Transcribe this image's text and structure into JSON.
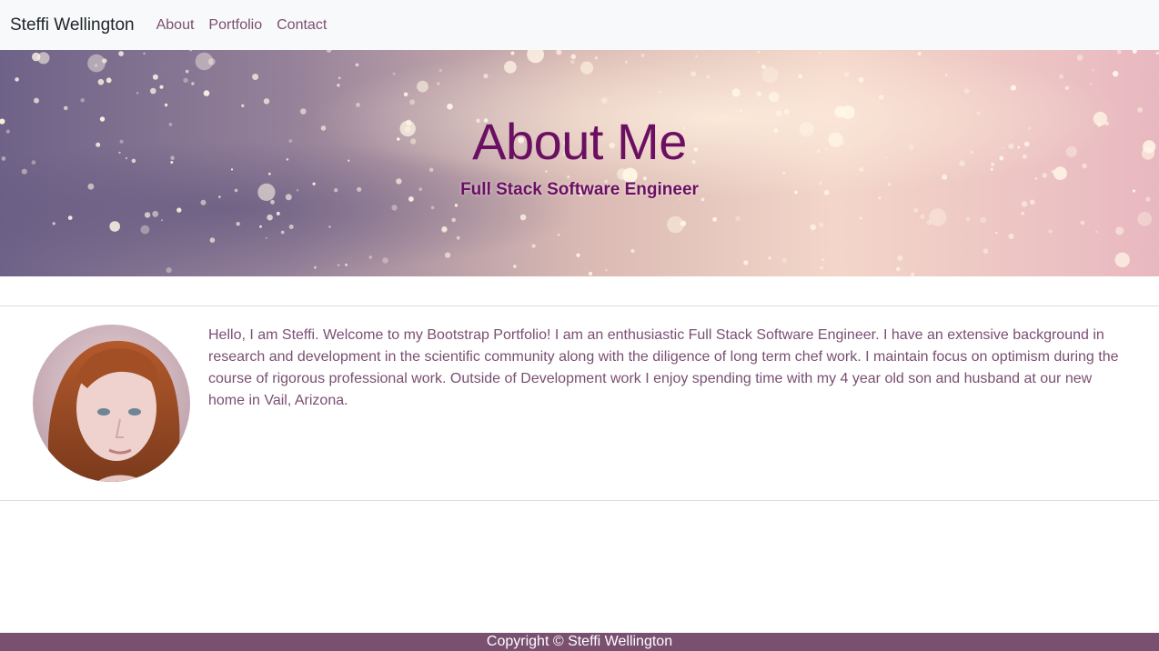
{
  "navbar": {
    "brand": "Steffi Wellington",
    "links": [
      {
        "label": "About"
      },
      {
        "label": "Portfolio"
      },
      {
        "label": "Contact"
      }
    ]
  },
  "hero": {
    "title": "About Me",
    "subtitle": "Full Stack Software Engineer"
  },
  "about": {
    "bio": "Hello, I am Steffi. Welcome to my Bootstrap Portfolio! I am an enthusiastic Full Stack Software Engineer. I have an extensive background in research and development in the scientific community along with the diligence of long term chef work. I maintain focus on optimism during the course of rigorous professional work. Outside of Development work I enjoy spending time with my 4 year old son and husband at our new home in Vail, Arizona."
  },
  "footer": {
    "copyright": "Copyright © Steffi Wellington"
  },
  "colors": {
    "accent": "#7a4f73",
    "hero_text": "#6b0f62",
    "footer_bg": "#7a5070",
    "navbar_bg": "#f8f9fa"
  },
  "icons": {
    "hero_background": "sparkle-bokeh-image",
    "avatar": "profile-photo"
  }
}
